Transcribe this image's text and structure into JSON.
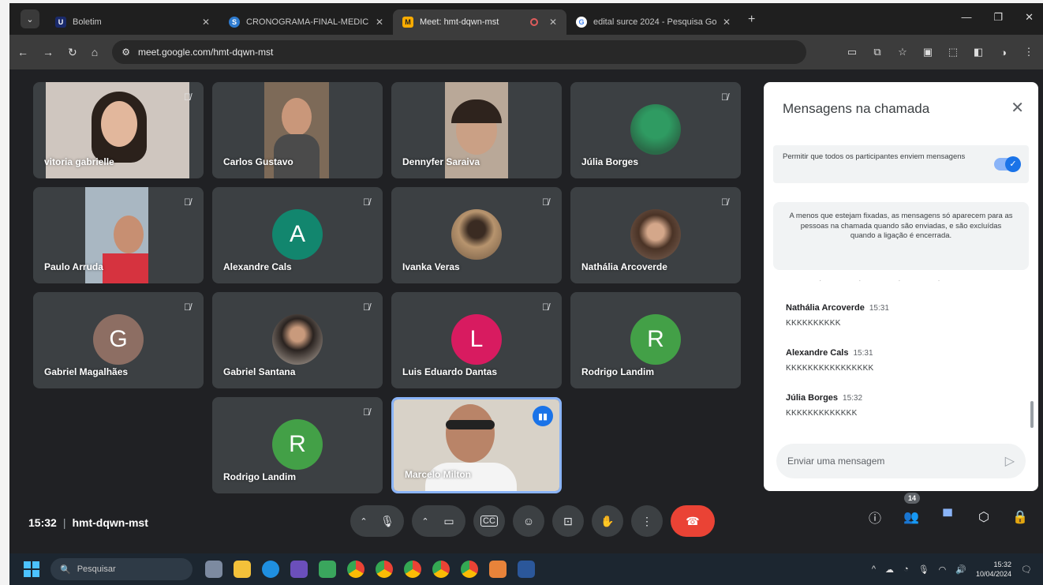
{
  "browser": {
    "tabs": [
      {
        "title": "Boletim",
        "favicon": "U",
        "fav_color": "#1a2a6b"
      },
      {
        "title": "CRONOGRAMA-FINAL-MEDIC",
        "favicon": "S",
        "fav_color": "#2e7bcf"
      },
      {
        "title": "Meet: hmt-dqwn-mst",
        "favicon": "M",
        "fav_color": "#f9ab00"
      },
      {
        "title": "edital surce 2024 - Pesquisa Go",
        "favicon": "G",
        "fav_color": "#4285f4"
      }
    ],
    "url": "meet.google.com/hmt-dqwn-mst"
  },
  "participants": [
    {
      "name": "vitoria gabrielle",
      "type": "video",
      "muted": true,
      "bg": "#cfc6bf"
    },
    {
      "name": "Carlos Gustavo",
      "type": "video",
      "muted": false,
      "bg": "#7d6a58"
    },
    {
      "name": "Dennyfer Saraiva",
      "type": "video",
      "muted": false,
      "bg": "#b9a898"
    },
    {
      "name": "Júlia Borges",
      "type": "photo",
      "muted": true,
      "bg": "#3e8e5a"
    },
    {
      "name": "Paulo Arruda",
      "type": "video",
      "muted": true,
      "bg": "#a9b7c2"
    },
    {
      "name": "Alexandre Cals",
      "type": "initial",
      "initial": "A",
      "muted": true,
      "bg": "#12866e"
    },
    {
      "name": "Ivanka Veras",
      "type": "photo",
      "muted": true,
      "bg": "#9c7d5a"
    },
    {
      "name": "Nathália Arcoverde",
      "type": "photo",
      "muted": true,
      "bg": "#6d5446"
    },
    {
      "name": "Gabriel Magalhães",
      "type": "initial",
      "initial": "G",
      "muted": true,
      "bg": "#8d6e63"
    },
    {
      "name": "Gabriel Santana",
      "type": "photo",
      "muted": true,
      "bg": "#5a5048"
    },
    {
      "name": "Luis Eduardo Dantas",
      "type": "initial",
      "initial": "L",
      "muted": true,
      "bg": "#d81b60"
    },
    {
      "name": "Rodrigo Landim",
      "type": "initial",
      "initial": "R",
      "muted": false,
      "bg": "#43a047"
    },
    {
      "name": "Rodrigo Landim",
      "type": "initial",
      "initial": "R",
      "muted": true,
      "bg": "#43a047"
    },
    {
      "name": "Marcelo Milton",
      "type": "video",
      "muted": false,
      "speaking": true,
      "bg": "#d8d2c8"
    }
  ],
  "chat": {
    "title": "Mensagens na chamada",
    "permission_text": "Permitir que todos os participantes enviem mensagens",
    "info_text": "A menos que estejam fixadas, as mensagens só aparecem para as pessoas na chamada quando são enviadas, e são excluídas quando a ligação é encerrada.",
    "messages": [
      {
        "author": "Nathália Arcoverde",
        "time": "15:31",
        "text": "KKKKKKKKKK"
      },
      {
        "author": "Alexandre Cals",
        "time": "15:31",
        "text": "KKKKKKKKKKKKKKKK"
      },
      {
        "author": "Júlia Borges",
        "time": "15:32",
        "text": "KKKKKKKKKKKKK"
      }
    ],
    "input_placeholder": "Enviar uma mensagem"
  },
  "meeting": {
    "time": "15:32",
    "code": "hmt-dqwn-mst",
    "participant_count": "14"
  },
  "taskbar": {
    "search_placeholder": "Pesquisar",
    "clock_time": "15:32",
    "clock_date": "10/04/2024"
  }
}
